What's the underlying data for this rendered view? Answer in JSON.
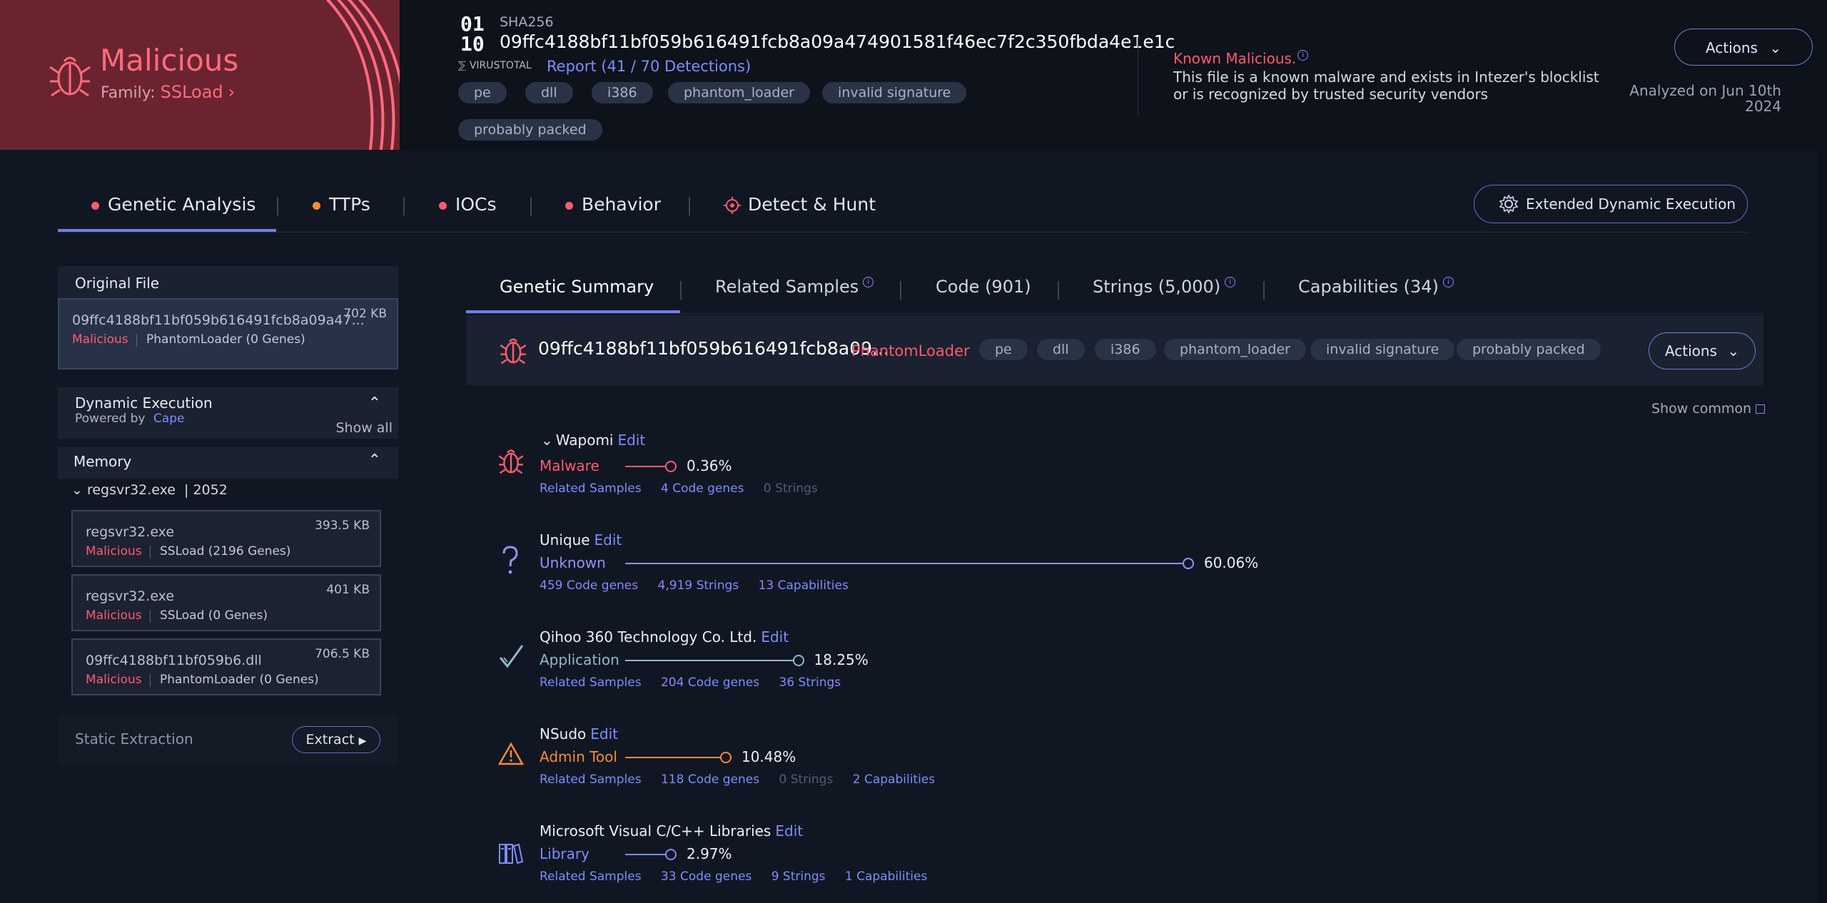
{
  "verdict": {
    "title": "Malicious",
    "family_label": "Family:",
    "family": "SSLoad"
  },
  "file": {
    "hash_type": "SHA256",
    "hash": "09ffc4188bf11bf059b616491fcb8a09a474901581f46ec7f2c350fbda4e1e1c",
    "virustotal_label": "VIRUSTOTAL",
    "virustotal_report": "Report (41 / 70 Detections)",
    "tags": [
      "pe",
      "dll",
      "i386",
      "phantom_loader",
      "invalid signature",
      "probably packed"
    ]
  },
  "known": {
    "title": "Known Malicious.",
    "description": "This file is a known malware and exists in Intezer's blocklist or is recognized by trusted security vendors"
  },
  "header_actions_label": "Actions",
  "analyzed": {
    "line1": "Analyzed on Jun 10th",
    "line2": "2024"
  },
  "tabs": [
    {
      "label": "Genetic Analysis",
      "dot_color": "#ff5a6e"
    },
    {
      "label": "TTPs",
      "dot_color": "#f58a3c"
    },
    {
      "label": "IOCs",
      "dot_color": "#ff5a6e"
    },
    {
      "label": "Behavior",
      "dot_color": "#ff5a6e"
    },
    {
      "label": "Detect & Hunt"
    }
  ],
  "extended_button": "Extended Dynamic Execution",
  "sidebar": {
    "original_file_title": "Original File",
    "original_file": {
      "name": "09ffc4188bf11bf059b616491fcb8a09a47...",
      "size": "702 KB",
      "status": "Malicious",
      "family": "PhantomLoader (0 Genes)"
    },
    "dynamic": {
      "title": "Dynamic Execution",
      "powered_by": "Powered by",
      "provider": "Cape",
      "show_all": "Show all"
    },
    "memory": {
      "title": "Memory",
      "process": "regsvr32.exe",
      "pid": "2052"
    },
    "memory_files": [
      {
        "name": "regsvr32.exe",
        "size": "393.5 KB",
        "status": "Malicious",
        "family": "SSLoad (2196 Genes)"
      },
      {
        "name": "regsvr32.exe",
        "size": "401 KB",
        "status": "Malicious",
        "family": "SSLoad (0 Genes)"
      },
      {
        "name": "09ffc4188bf11bf059b6.dll",
        "size": "706.5 KB",
        "status": "Malicious",
        "family": "PhantomLoader (0 Genes)"
      }
    ],
    "static_extraction": "Static Extraction",
    "extract_button": "Extract"
  },
  "subtabs": [
    "Genetic Summary",
    "Related Samples",
    "Code (901)",
    "Strings (5,000)",
    "Capabilities (34)"
  ],
  "sample_bar": {
    "name": "09ffc4188bf11bf059b616491fcb8a09...",
    "family": "PhantomLoader",
    "tags": [
      "pe",
      "dll",
      "i386",
      "phantom_loader",
      "invalid signature",
      "probably packed"
    ],
    "actions": "Actions"
  },
  "show_common": "Show common",
  "edit_label": "Edit",
  "genes": [
    {
      "name": "Wapomi",
      "type": "Malware",
      "percent": "0.36%",
      "share": 0.0036,
      "color": "#ff5a6e",
      "icon": "bug-icon",
      "links": [
        {
          "text": "Related Samples",
          "dim": false
        },
        {
          "text": "4 Code genes",
          "dim": false
        },
        {
          "text": "0 Strings",
          "dim": true
        }
      ]
    },
    {
      "name": "Unique",
      "type": "Unknown",
      "percent": "60.06%",
      "share": 0.6006,
      "color": "#9a8cff",
      "icon": "question-icon",
      "links": [
        {
          "text": "459 Code genes",
          "dim": false
        },
        {
          "text": "4,919 Strings",
          "dim": false
        },
        {
          "text": "13 Capabilities",
          "dim": false
        }
      ]
    },
    {
      "name": "Qihoo 360 Technology Co. Ltd.",
      "type": "Application",
      "percent": "18.25%",
      "share": 0.1825,
      "color": "#8fb8c8",
      "icon": "check-icon",
      "links": [
        {
          "text": "Related Samples",
          "dim": false
        },
        {
          "text": "204 Code genes",
          "dim": false
        },
        {
          "text": "36 Strings",
          "dim": false
        }
      ]
    },
    {
      "name": "NSudo",
      "type": "Admin Tool",
      "percent": "10.48%",
      "share": 0.1048,
      "color": "#f58a3c",
      "icon": "warning-icon",
      "links": [
        {
          "text": "Related Samples",
          "dim": false
        },
        {
          "text": "118 Code genes",
          "dim": false
        },
        {
          "text": "0 Strings",
          "dim": true
        },
        {
          "text": "2 Capabilities",
          "dim": false
        }
      ]
    },
    {
      "name": "Microsoft Visual C/C++ Libraries",
      "type": "Library",
      "percent": "2.97%",
      "share": 0.0297,
      "color": "#7e8cff",
      "icon": "library-icon",
      "links": [
        {
          "text": "Related Samples",
          "dim": false
        },
        {
          "text": "33 Code genes",
          "dim": false
        },
        {
          "text": "9 Strings",
          "dim": false
        },
        {
          "text": "1 Capabilities",
          "dim": false
        }
      ]
    }
  ]
}
